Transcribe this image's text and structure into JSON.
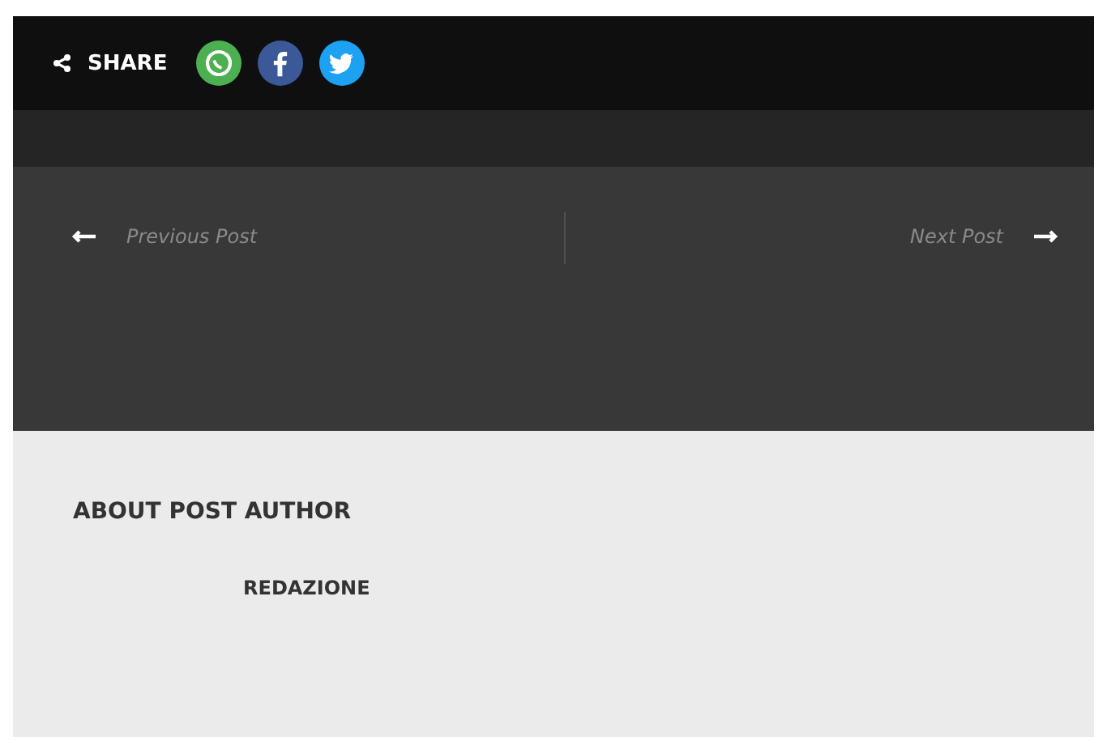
{
  "share_bar": {
    "label": "SHARE",
    "buttons": [
      {
        "kind": "whatsapp",
        "color": "#4caf50"
      },
      {
        "kind": "facebook",
        "color": "#3b5998"
      },
      {
        "kind": "twitter",
        "color": "#1da1f2"
      }
    ]
  },
  "post_nav": {
    "previous": "Previous Post",
    "next": "Next Post"
  },
  "author_box": {
    "heading": "ABOUT POST AUTHOR",
    "author_name": "REDAZIONE"
  }
}
